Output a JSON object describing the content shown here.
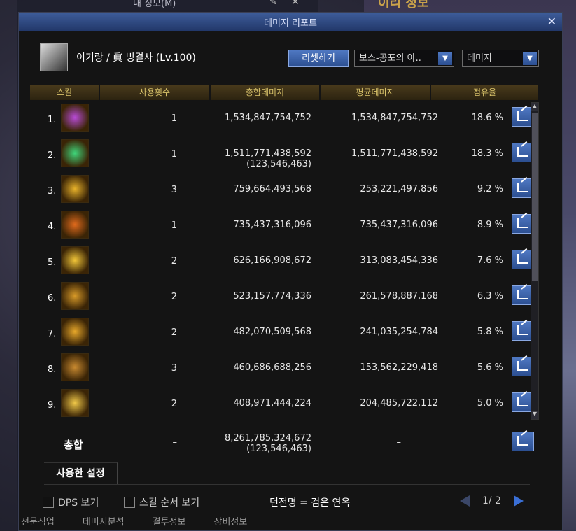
{
  "background": {
    "info_title": "내 정보(M)",
    "right_title": "이리 정보",
    "bottom_tabs": [
      "전문직업",
      "데미지분석",
      "결투정보",
      "장비정보"
    ]
  },
  "window": {
    "title": "데미지 리포트",
    "close": "✕",
    "player_name": "이기랑 / 眞 빙결사 (Lv.100)",
    "reset_label": "리셋하기",
    "boss_select": "보스-공포의 아..",
    "metric_select": "데미지"
  },
  "table": {
    "headers": [
      "스킬",
      "사용횟수",
      "총합데미지",
      "평균데미지",
      "점유율"
    ],
    "rows": [
      {
        "num": "1.",
        "uses": "1",
        "total": "1,534,847,754,752",
        "total_sub": "",
        "avg": "1,534,847,754,752",
        "share": "18.6 %",
        "color": "#b84bd6"
      },
      {
        "num": "2.",
        "uses": "1",
        "total": "1,511,771,438,592",
        "total_sub": "(123,546,463)",
        "avg": "1,511,771,438,592",
        "share": "18.3 %",
        "color": "#3fd67a"
      },
      {
        "num": "3.",
        "uses": "3",
        "total": "759,664,493,568",
        "total_sub": "",
        "avg": "253,221,497,856",
        "share": "9.2 %",
        "color": "#e8b22a"
      },
      {
        "num": "4.",
        "uses": "1",
        "total": "735,437,316,096",
        "total_sub": "",
        "avg": "735,437,316,096",
        "share": "8.9 %",
        "color": "#e06a1c"
      },
      {
        "num": "5.",
        "uses": "2",
        "total": "626,166,908,672",
        "total_sub": "",
        "avg": "313,083,454,336",
        "share": "7.6 %",
        "color": "#f2c638"
      },
      {
        "num": "6.",
        "uses": "2",
        "total": "523,157,774,336",
        "total_sub": "",
        "avg": "261,578,887,168",
        "share": "6.3 %",
        "color": "#d89a28"
      },
      {
        "num": "7.",
        "uses": "2",
        "total": "482,070,509,568",
        "total_sub": "",
        "avg": "241,035,254,784",
        "share": "5.8 %",
        "color": "#e8a82a"
      },
      {
        "num": "8.",
        "uses": "3",
        "total": "460,686,688,256",
        "total_sub": "",
        "avg": "153,562,229,418",
        "share": "5.6 %",
        "color": "#c98a30"
      },
      {
        "num": "9.",
        "uses": "2",
        "total": "408,971,444,224",
        "total_sub": "",
        "avg": "204,485,722,112",
        "share": "5.0 %",
        "color": "#f0c848"
      }
    ],
    "total": {
      "label": "총합",
      "uses": "–",
      "total": "8,261,785,324,672",
      "total_sub": "(123,546,463)",
      "avg": "–"
    }
  },
  "footer": {
    "settings_tab": "사용한 설정",
    "dps_label": "DPS 보기",
    "skill_order_label": "스킬 순서 보기",
    "dungeon": "던전명 = 검은 연옥",
    "page": "1/ 2"
  }
}
